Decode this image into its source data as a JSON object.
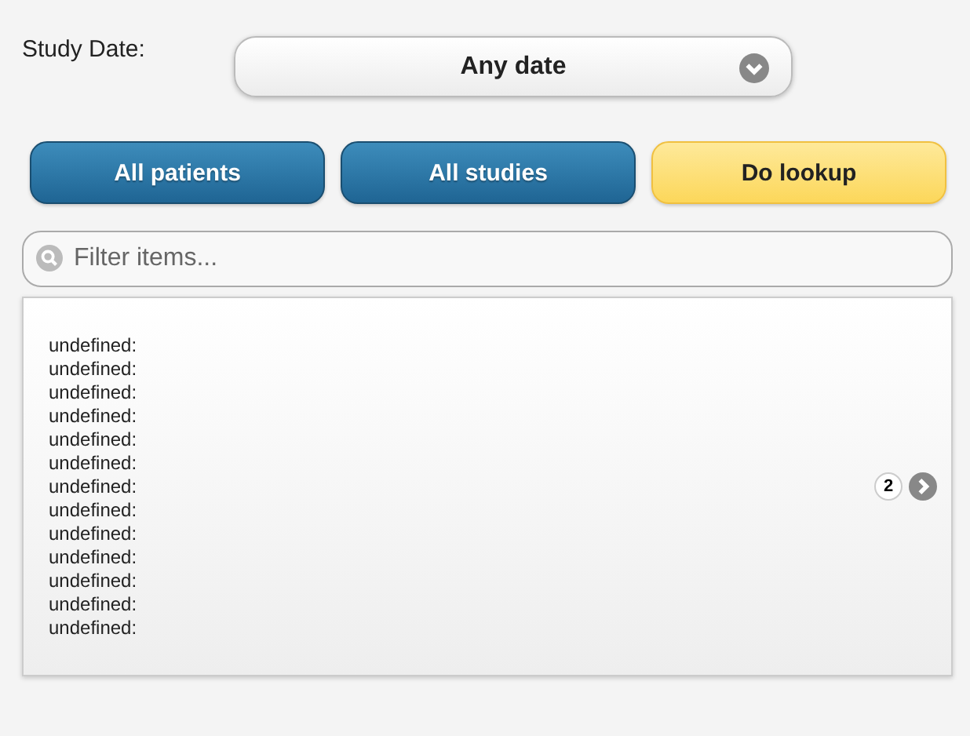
{
  "study_date": {
    "label": "Study Date:",
    "value": "Any date"
  },
  "buttons": [
    {
      "label": "All patients",
      "kind": "primary"
    },
    {
      "label": "All studies",
      "kind": "primary"
    },
    {
      "label": "Do lookup",
      "kind": "accent"
    }
  ],
  "filter": {
    "placeholder": "Filter items..."
  },
  "list_item": {
    "lines": [
      "undefined:",
      "undefined:",
      "undefined:",
      "undefined:",
      "undefined:",
      "undefined:",
      "undefined:",
      "undefined:",
      "undefined:",
      "undefined:",
      "undefined:",
      "undefined:",
      "undefined:"
    ],
    "count": "2"
  }
}
